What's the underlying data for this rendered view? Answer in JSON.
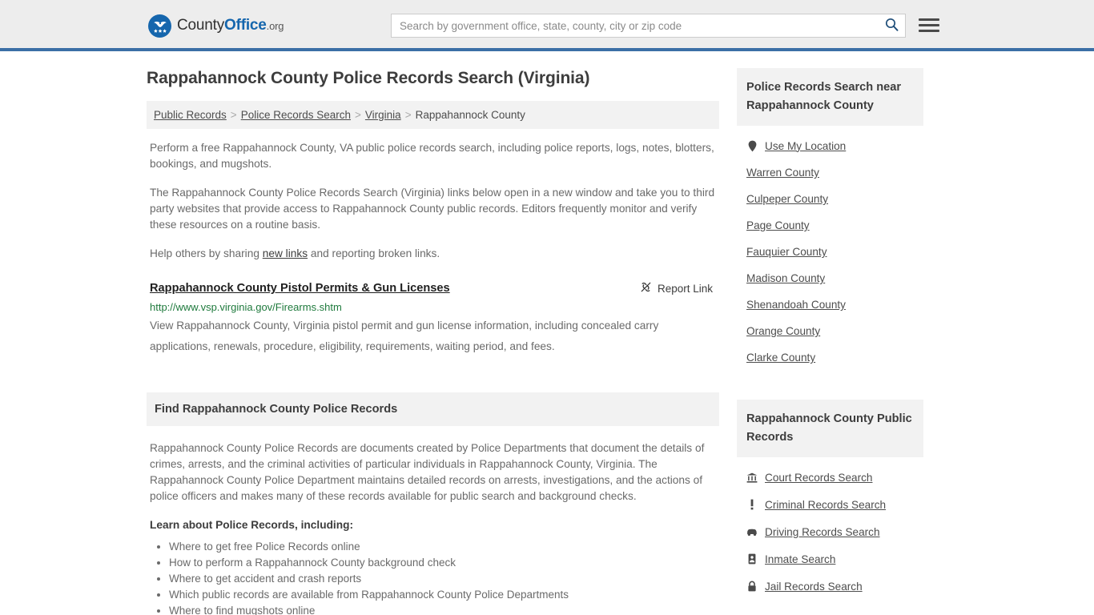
{
  "header": {
    "logo": {
      "part1": "County",
      "part2": "Office",
      "tld": ".org",
      "icon": "eagle-shield-icon"
    },
    "search": {
      "placeholder": "Search by government office, state, county, city or zip code",
      "value": "",
      "button_icon": "search-icon"
    },
    "menu_icon": "hamburger-menu-icon",
    "accent_color": "#3b6fa6"
  },
  "main": {
    "title": "Rappahannock County Police Records Search (Virginia)",
    "breadcrumb": [
      "Public Records",
      "Police Records Search",
      "Virginia",
      "Rappahannock County"
    ],
    "breadcrumb_separator": ">",
    "intro_paragraphs": [
      "Perform a free Rappahannock County, VA public police records search, including police reports, logs, notes, blotters, bookings, and mugshots.",
      "The Rappahannock County Police Records Search (Virginia) links below open in a new window and take you to third party websites that provide access to Rappahannock County public records. Editors frequently monitor and verify these resources on a routine basis."
    ],
    "help_line": {
      "before": "Help others by sharing ",
      "link": "new links",
      "after": " and reporting broken links."
    },
    "results": [
      {
        "title": "Rappahannock County Pistol Permits & Gun Licenses",
        "url": "http://www.vsp.virginia.gov/Firearms.shtm",
        "description": "View Rappahannock County, Virginia pistol permit and gun license information, including concealed carry applications, renewals, procedure, eligibility, requirements, waiting period, and fees.",
        "report_label": "Report Link",
        "report_icon": "broken-link-icon"
      }
    ],
    "section": {
      "heading": "Find Rappahannock County Police Records",
      "paragraph": "Rappahannock County Police Records are documents created by Police Departments that document the details of crimes, arrests, and the criminal activities of particular individuals in Rappahannock County, Virginia. The Rappahannock County Police Department maintains detailed records on arrests, investigations, and the actions of police officers and makes many of these records available for public search and background checks.",
      "learn_heading": "Learn about Police Records, including:",
      "learn_items": [
        "Where to get free Police Records online",
        "How to perform a Rappahannock County background check",
        "Where to get accident and crash reports",
        "Which public records are available from Rappahannock County Police Departments",
        "Where to find mugshots online"
      ]
    }
  },
  "sidebar": {
    "nearby": {
      "heading": "Police Records Search near Rappahannock County",
      "items": [
        {
          "label": "Use My Location",
          "icon": "map-pin-icon"
        },
        {
          "label": "Warren County",
          "icon": ""
        },
        {
          "label": "Culpeper County",
          "icon": ""
        },
        {
          "label": "Page County",
          "icon": ""
        },
        {
          "label": "Fauquier County",
          "icon": ""
        },
        {
          "label": "Madison County",
          "icon": ""
        },
        {
          "label": "Shenandoah County",
          "icon": ""
        },
        {
          "label": "Orange County",
          "icon": ""
        },
        {
          "label": "Clarke County",
          "icon": ""
        }
      ]
    },
    "public_records": {
      "heading": "Rappahannock County Public Records",
      "items": [
        {
          "label": "Court Records Search",
          "icon": "courthouse-icon"
        },
        {
          "label": "Criminal Records Search",
          "icon": "exclamation-icon"
        },
        {
          "label": "Driving Records Search",
          "icon": "car-icon"
        },
        {
          "label": "Inmate Search",
          "icon": "id-card-icon"
        },
        {
          "label": "Jail Records Search",
          "icon": "lock-icon"
        }
      ]
    }
  }
}
